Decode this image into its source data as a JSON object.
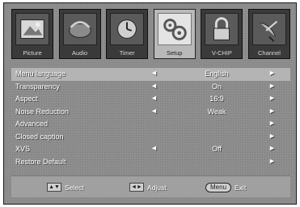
{
  "tabs": [
    {
      "label": "Picture",
      "icon": "picture-icon",
      "active": false
    },
    {
      "label": "Audio",
      "icon": "audio-icon",
      "active": false
    },
    {
      "label": "Timer",
      "icon": "timer-icon",
      "active": false
    },
    {
      "label": "Setup",
      "icon": "setup-icon",
      "active": true
    },
    {
      "label": "V-CHIP",
      "icon": "lock-icon",
      "active": false
    },
    {
      "label": "Channel",
      "icon": "satellite-dish-icon",
      "active": false
    }
  ],
  "menu": [
    {
      "name": "Menu language",
      "value": "English",
      "left_arrow": true,
      "right_arrow": true,
      "selected": true
    },
    {
      "name": "Transparency",
      "value": "On",
      "left_arrow": true,
      "right_arrow": true,
      "selected": false
    },
    {
      "name": "Aspect",
      "value": "16:9",
      "left_arrow": true,
      "right_arrow": true,
      "selected": false
    },
    {
      "name": "Noise  Reduction",
      "value": "Weak",
      "left_arrow": true,
      "right_arrow": true,
      "selected": false
    },
    {
      "name": "Advanced",
      "value": "",
      "left_arrow": false,
      "right_arrow": true,
      "selected": false
    },
    {
      "name": "Closed caption",
      "value": "",
      "left_arrow": false,
      "right_arrow": true,
      "selected": false
    },
    {
      "name": "XVS",
      "value": "Off",
      "left_arrow": true,
      "right_arrow": true,
      "selected": false
    },
    {
      "name": "Restore Default",
      "value": "",
      "left_arrow": false,
      "right_arrow": true,
      "selected": false
    }
  ],
  "arrows": {
    "left": "◄",
    "right": "►"
  },
  "help": {
    "select_label": "Select",
    "adjust_label": "Adjust",
    "menu_key": "Menu",
    "exit_label": "Exit"
  },
  "colors": {
    "panel": "#8e8e8e",
    "selected_row": "#b4b4b4",
    "active_tab": "#b9b9b9"
  }
}
